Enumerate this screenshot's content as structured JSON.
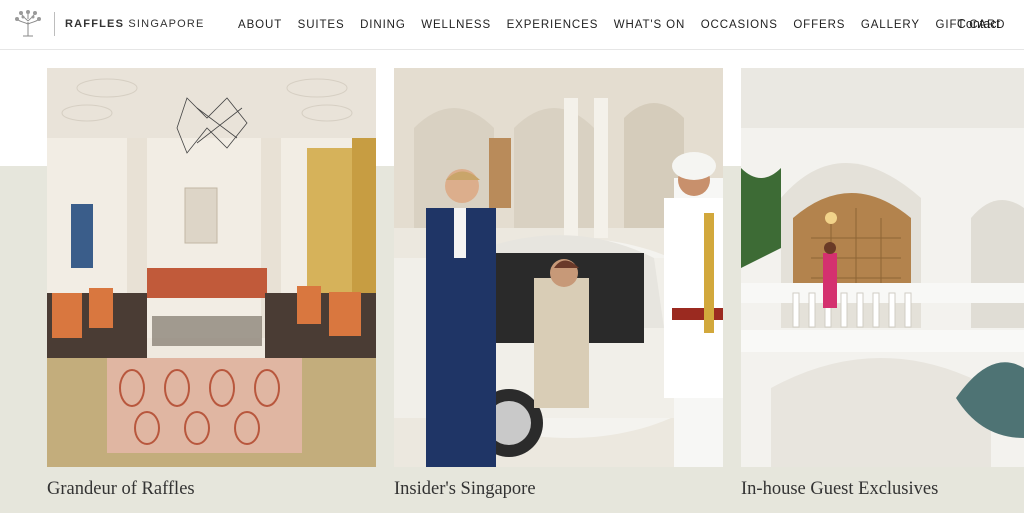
{
  "brand": {
    "name_bold": "RAFFLES",
    "name_rest": "SINGAPORE",
    "logo_icon": "raffles-tree-icon"
  },
  "nav": {
    "items": [
      "ABOUT",
      "SUITES",
      "DINING",
      "WELLNESS",
      "EXPERIENCES",
      "WHAT'S ON",
      "OCCASIONS",
      "OFFERS",
      "GALLERY",
      "GIFT CARD"
    ],
    "contact": "Contact"
  },
  "cards": [
    {
      "title": "Grandeur of Raffles",
      "image": "suite-living-room-photo"
    },
    {
      "title": "Insider's Singapore",
      "image": "doorman-car-arrival-photo"
    },
    {
      "title": "In-house Guest Exclusives",
      "image": "colonial-veranda-photo"
    }
  ],
  "colors": {
    "band": "#e6e6dc",
    "text": "#222222"
  }
}
